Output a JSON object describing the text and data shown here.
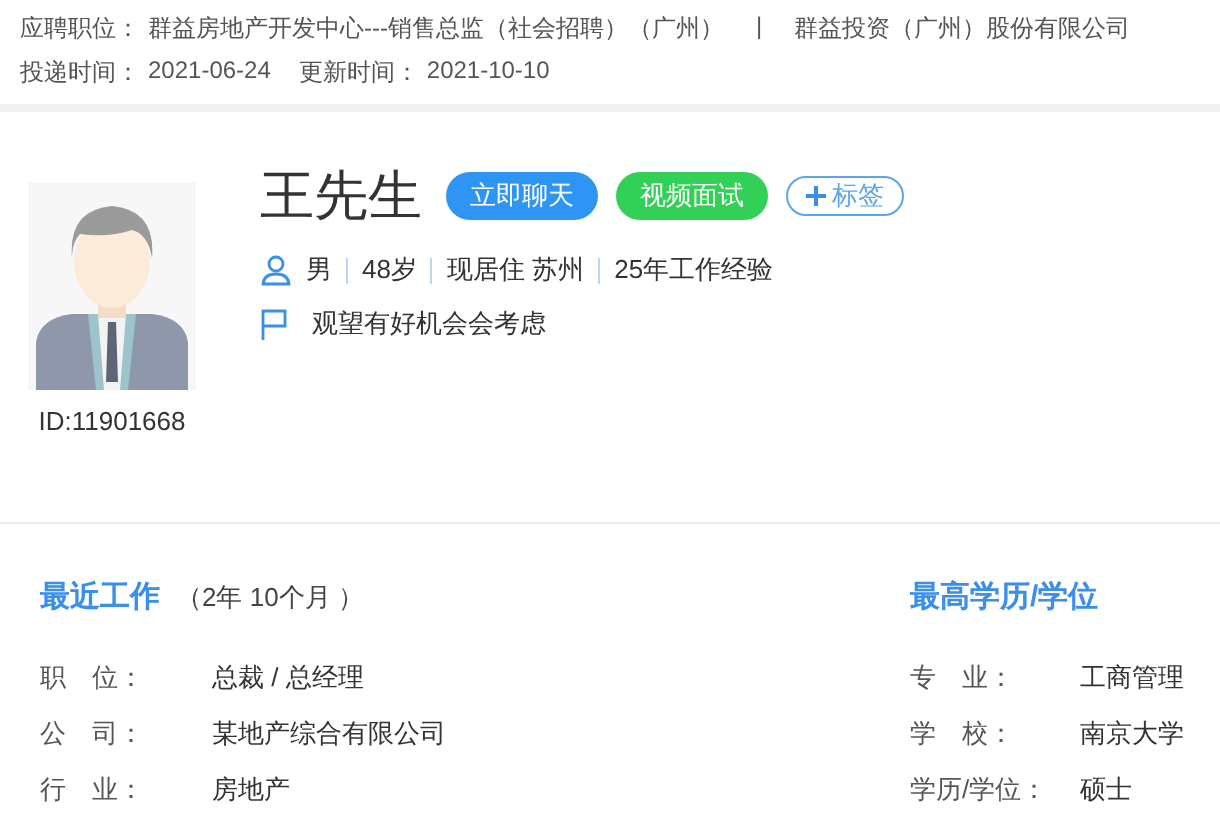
{
  "application": {
    "position_label": "应聘职位：",
    "position": "群益房地产开发中心---销售总监（社会招聘）（广州）",
    "separator": "|",
    "company": "群益投资（广州）股份有限公司",
    "submitted_label": "投递时间：",
    "submitted": "2021-06-24",
    "updated_label": "更新时间：",
    "updated": "2021-10-10"
  },
  "profile": {
    "name": "王先生",
    "id": "ID:11901668",
    "buttons": [
      {
        "kind": "chat",
        "label": "立即聊天"
      },
      {
        "kind": "video",
        "label": "视频面试"
      },
      {
        "kind": "tag",
        "label": "标签"
      }
    ],
    "facts": [
      "男",
      "48岁",
      "现居住 苏州",
      "25年工作经验"
    ],
    "status": "观望有好机会会考虑"
  },
  "recent_work": {
    "title": "最近工作",
    "duration": "（2年 10个月 ）",
    "rows": [
      {
        "label": "职　位：",
        "value": "总裁 / 总经理"
      },
      {
        "label": "公　司：",
        "value": "某地产综合有限公司"
      },
      {
        "label": "行　业：",
        "value": "房地产"
      }
    ]
  },
  "education": {
    "title": "最高学历/学位",
    "rows": [
      {
        "label": "专　业：",
        "value": "工商管理"
      },
      {
        "label": "学　校：",
        "value": "南京大学"
      },
      {
        "label": "学历/学位：",
        "value": "硕士"
      }
    ]
  }
}
